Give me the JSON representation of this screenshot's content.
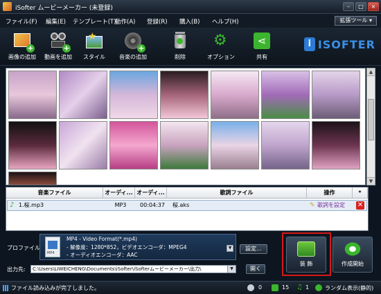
{
  "window": {
    "title": "iSofter ムービーメーカー (未登録)"
  },
  "menu": {
    "items": [
      "ファイル(F)",
      "編集(E)",
      "テンプレート(T)",
      "動作(A)",
      "登録(R)",
      "購入(B)",
      "ヘルプ(H)"
    ],
    "extension_tools": "拡張ツール"
  },
  "toolbar": {
    "buttons": [
      "画像の追加",
      "動画を追加",
      "スタイル",
      "音楽の追加",
      "削除",
      "オプション",
      "共有"
    ],
    "logo_text": "ISOFTER"
  },
  "gallery": {
    "thumbnails": [
      {
        "icon": "photo-blossom-pink"
      },
      {
        "icon": "photo-blossom-branch"
      },
      {
        "icon": "photo-blossom-sky"
      },
      {
        "icon": "photo-blossom-dark"
      },
      {
        "icon": "photo-blossom-tree"
      },
      {
        "icon": "photo-blossom-garden"
      },
      {
        "icon": "photo-blossom-weeping"
      },
      {
        "icon": "photo-blossom-night"
      },
      {
        "icon": "photo-blossom-tree"
      },
      {
        "icon": "photo-blossom-pink"
      },
      {
        "icon": "photo-blossom-park"
      },
      {
        "icon": "photo-blossom-avenue"
      },
      {
        "icon": "photo-blossom-trees"
      },
      {
        "icon": "photo-blossom-weeping"
      },
      {
        "icon": "photo-blossom-night"
      }
    ]
  },
  "music_table": {
    "headers": [
      "音楽ファイル",
      "オーディ...",
      "オーディ...",
      "歌詞ファイル",
      "操作",
      "*"
    ],
    "rows": [
      {
        "file": "1.桜.mp3",
        "format": "MP3",
        "duration": "00:04:37",
        "lyrics": "桜.aks",
        "action": "歌詞を設定"
      }
    ]
  },
  "output": {
    "profile_label": "プロファイル:",
    "profile_lines": [
      "MP4 - Video Format(*.mp4)",
      "- 解像度：1280*852，ビデオエンコーダ：MPEG4",
      "- オーディオエンコーダ：AAC"
    ],
    "profile_icon_text": "MP4",
    "settings_button": "設定...",
    "dest_label": "出力先:",
    "dest_path": "C:\\Users\\LIWEICHENG\\Documents\\iSofter\\iSofterムービーメーカー\\出力\\",
    "open_button": "開く",
    "decorate_button": "装 飾",
    "create_button": "作成開始"
  },
  "status": {
    "message": "ファイル読み込みが完了しました。",
    "count_a": "0",
    "count_b": "15",
    "count_c": "1",
    "mode": "ランダム表示(静的)"
  },
  "colors": {
    "accent": "#2c7bd6",
    "highlight": "#d81818",
    "row_select": "#e4ecf5"
  }
}
